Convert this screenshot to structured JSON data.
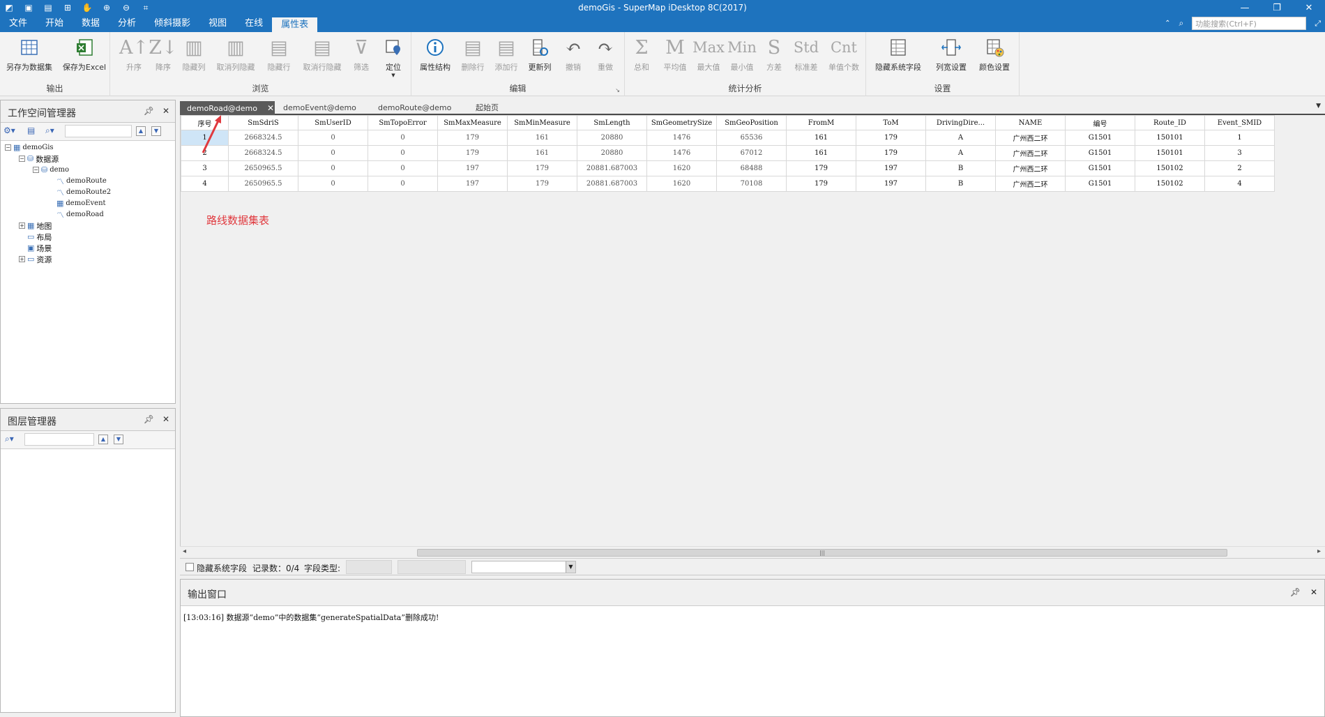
{
  "window": {
    "title": "demoGis - SuperMap iDesktop 8C(2017)",
    "controls": [
      "—",
      "❐",
      "✕"
    ]
  },
  "menu": {
    "tabs": [
      "文件",
      "开始",
      "数据",
      "分析",
      "倾斜摄影",
      "视图",
      "在线",
      "属性表"
    ],
    "search_placeholder": "功能搜索(Ctrl+F)"
  },
  "ribbon": {
    "groups": [
      {
        "name": "输出",
        "buttons": [
          "另存为数据集",
          "保存为Excel"
        ]
      },
      {
        "name": "浏览",
        "buttons": [
          "升序",
          "降序",
          "隐藏列",
          "取消列隐藏",
          "隐藏行",
          "取消行隐藏",
          "筛选",
          "定位"
        ]
      },
      {
        "name": "编辑",
        "buttons": [
          "属性结构",
          "删除行",
          "添加行",
          "更新列",
          "撤销",
          "重做"
        ]
      },
      {
        "name": "统计分析",
        "buttons": [
          "总和",
          "平均值",
          "最大值",
          "最小值",
          "方差",
          "标准差",
          "单值个数"
        ],
        "glyphs": [
          "Σ",
          "M",
          "Max",
          "Min",
          "S",
          "Std",
          "Cnt"
        ]
      },
      {
        "name": "设置",
        "buttons": [
          "隐藏系统字段",
          "列宽设置",
          "颜色设置"
        ]
      }
    ]
  },
  "workspace_panel": {
    "title": "工作空间管理器",
    "tree": [
      "demoGis",
      "数据源",
      "demo",
      "demoRoute",
      "demoRoute2",
      "demoEvent",
      "demoRoad",
      "地图",
      "布局",
      "场景",
      "资源"
    ]
  },
  "layer_panel": {
    "title": "图层管理器"
  },
  "doc_tabs": [
    "demoRoad@demo",
    "demoEvent@demo",
    "demoRoute@demo",
    "起始页"
  ],
  "table": {
    "columns": [
      "序号",
      "SmSdriS",
      "SmUserID",
      "SmTopoError",
      "SmMaxMeasure",
      "SmMinMeasure",
      "SmLength",
      "SmGeometrySize",
      "SmGeoPosition",
      "FromM",
      "ToM",
      "DrivingDire...",
      "NAME",
      "编号",
      "Route_ID",
      "Event_SMID"
    ],
    "rows": [
      [
        "1",
        "2668324.5",
        "0",
        "0",
        "179",
        "161",
        "20880",
        "1476",
        "65536",
        "161",
        "179",
        "A",
        "广州西二环",
        "G1501",
        "150101",
        "1"
      ],
      [
        "2",
        "2668324.5",
        "0",
        "0",
        "179",
        "161",
        "20880",
        "1476",
        "67012",
        "161",
        "179",
        "A",
        "广州西二环",
        "G1501",
        "150101",
        "3"
      ],
      [
        "3",
        "2650965.5",
        "0",
        "0",
        "197",
        "179",
        "20881.687003",
        "1620",
        "68488",
        "179",
        "197",
        "B",
        "广州西二环",
        "G1501",
        "150102",
        "2"
      ],
      [
        "4",
        "2650965.5",
        "0",
        "0",
        "197",
        "179",
        "20881.687003",
        "1620",
        "70108",
        "179",
        "197",
        "B",
        "广州西二环",
        "G1501",
        "150102",
        "4"
      ]
    ]
  },
  "annotation": "路线数据集表",
  "status": {
    "hide_system_fields": "隐藏系统字段",
    "record_count": "记录数：0/4",
    "field_type": "字段类型:"
  },
  "output": {
    "title": "输出窗口",
    "message": "[13:03:16] 数据源“demo”中的数据集“generateSpatialData”删除成功!"
  },
  "colors": {
    "titlebar": "#1e73be",
    "selected_row": "#cfe5f7",
    "annotation": "#e0393e"
  }
}
